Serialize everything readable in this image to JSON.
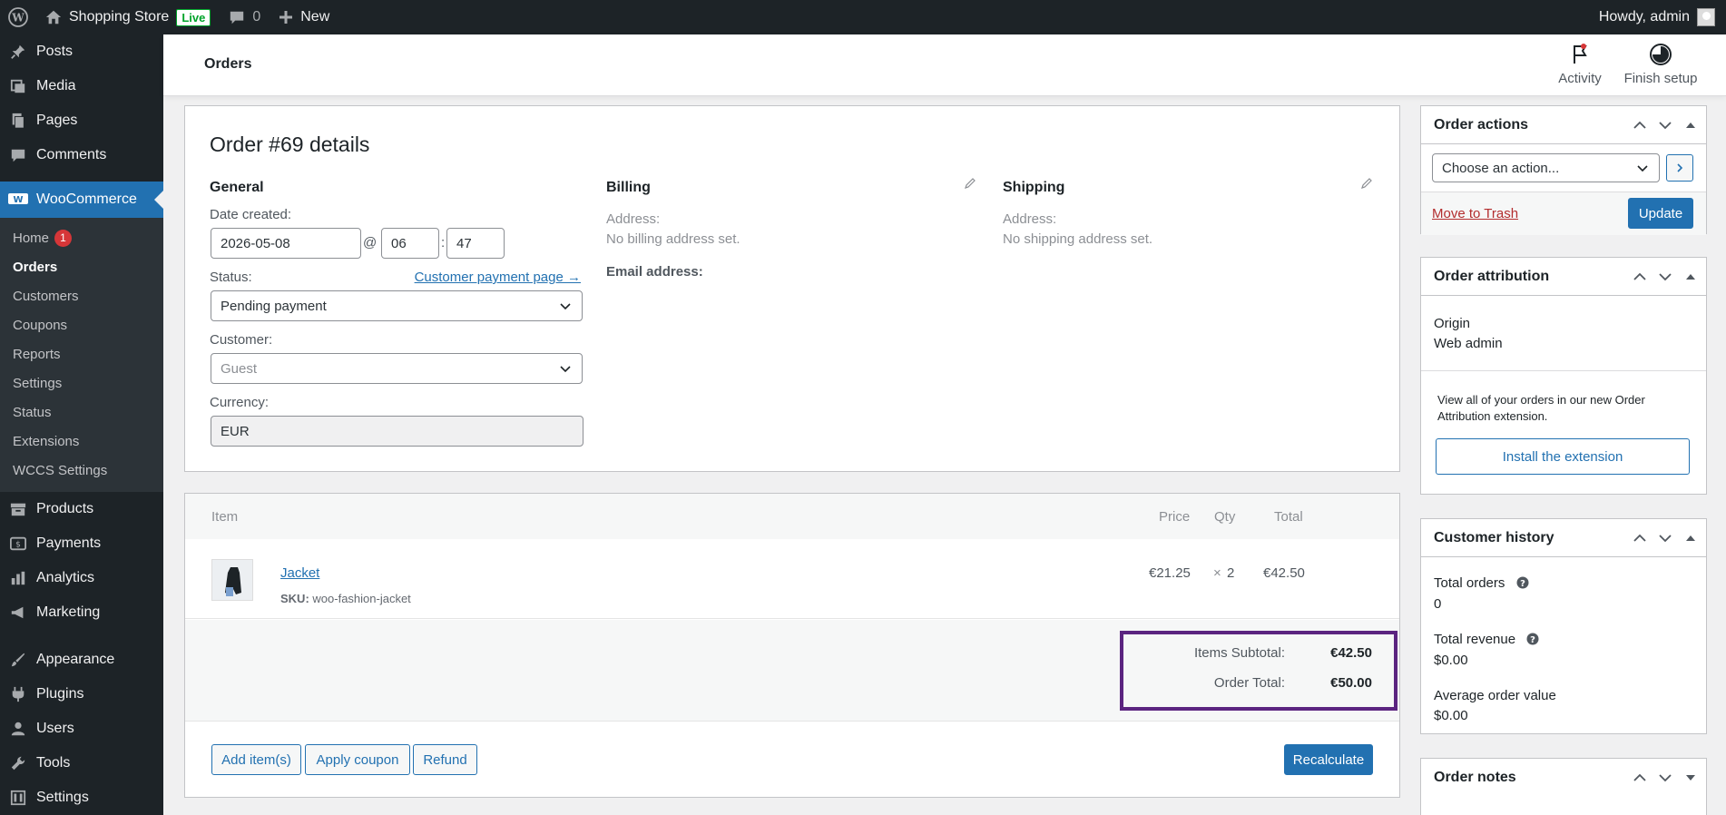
{
  "adminbar": {
    "site_name": "Shopping Store",
    "live_label": "Live",
    "comments_count": "0",
    "new_label": "New",
    "howdy": "Howdy, admin"
  },
  "sidebar": {
    "top_items": [
      {
        "label": "Posts",
        "icon": "pin-icon"
      },
      {
        "label": "Media",
        "icon": "media-icon"
      },
      {
        "label": "Pages",
        "icon": "pages-icon"
      },
      {
        "label": "Comments",
        "icon": "comment-icon"
      }
    ],
    "woocommerce_label": "WooCommerce",
    "woo_sub": [
      {
        "label": "Home",
        "badge": "1"
      },
      {
        "label": "Orders"
      },
      {
        "label": "Customers"
      },
      {
        "label": "Coupons"
      },
      {
        "label": "Reports"
      },
      {
        "label": "Settings"
      },
      {
        "label": "Status"
      },
      {
        "label": "Extensions"
      },
      {
        "label": "WCCS Settings"
      }
    ],
    "bottom_items": [
      {
        "label": "Products"
      },
      {
        "label": "Payments"
      },
      {
        "label": "Analytics"
      },
      {
        "label": "Marketing"
      },
      {
        "label": "Appearance"
      },
      {
        "label": "Plugins"
      },
      {
        "label": "Users"
      },
      {
        "label": "Tools"
      },
      {
        "label": "Settings"
      }
    ]
  },
  "header": {
    "title": "Orders",
    "activity": "Activity",
    "finish_setup": "Finish setup"
  },
  "order": {
    "title": "Order #69 details",
    "general": {
      "heading": "General",
      "date_label": "Date created:",
      "date": "2026-05-08",
      "at": "@",
      "hour": "06",
      "colon": ":",
      "minute": "47",
      "status_label": "Status:",
      "payment_page_link": "Customer payment page →",
      "status": "Pending payment",
      "customer_label": "Customer:",
      "customer_placeholder": "Guest",
      "currency_label": "Currency:",
      "currency": "EUR"
    },
    "billing": {
      "heading": "Billing",
      "address_label": "Address:",
      "address": "No billing address set.",
      "email_label": "Email address:"
    },
    "shipping": {
      "heading": "Shipping",
      "address_label": "Address:",
      "address": "No shipping address set."
    }
  },
  "items": {
    "headers": {
      "item": "Item",
      "price": "Price",
      "qty": "Qty",
      "total": "Total"
    },
    "row": {
      "name": "Jacket",
      "sku_label": "SKU:",
      "sku": "woo-fashion-jacket",
      "price": "€21.25",
      "qty_x": "×",
      "qty": "2",
      "total": "€42.50"
    },
    "totals": {
      "subtotal_label": "Items Subtotal:",
      "subtotal": "€42.50",
      "order_total_label": "Order Total:",
      "order_total": "€50.00"
    },
    "buttons": {
      "add_items": "Add item(s)",
      "apply_coupon": "Apply coupon",
      "refund": "Refund",
      "recalculate": "Recalculate"
    }
  },
  "order_actions": {
    "title": "Order actions",
    "select": "Choose an action...",
    "trash": "Move to Trash",
    "update": "Update"
  },
  "attribution": {
    "title": "Order attribution",
    "origin_label": "Origin",
    "origin": "Web admin",
    "promo": "View all of your orders in our new Order Attribution extension.",
    "install": "Install the extension"
  },
  "customer_history": {
    "title": "Customer history",
    "total_orders_label": "Total orders",
    "total_orders": "0",
    "total_revenue_label": "Total revenue",
    "total_revenue": "$0.00",
    "aov_label": "Average order value",
    "aov": "$0.00"
  },
  "order_notes": {
    "title": "Order notes"
  },
  "colors": {
    "admin_dark": "#1d2327",
    "accent": "#2271b1",
    "highlight_box": "#5b2480",
    "badge_red": "#d63638"
  }
}
